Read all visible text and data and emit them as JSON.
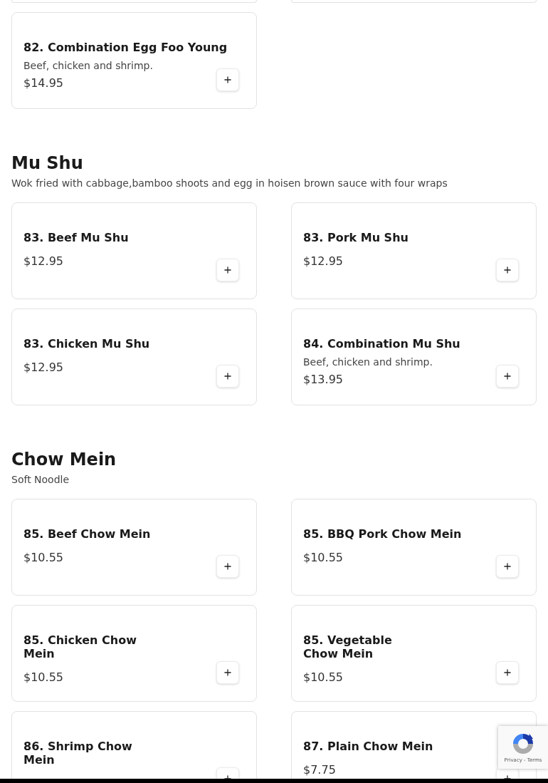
{
  "sections": [
    {
      "items": [
        {
          "kind": "partial"
        },
        {
          "kind": "partial"
        },
        {
          "kind": "item",
          "title_lines": [
            "82. Combination Egg Foo Young"
          ],
          "description": "Beef, chicken and shrimp.",
          "price": "$14.95"
        }
      ]
    },
    {
      "heading": "Mu Shu",
      "description": "Wok fried with cabbage,bamboo shoots and egg in hoisen brown sauce with four wraps",
      "items": [
        {
          "kind": "item",
          "title_lines": [
            "83. Beef Mu Shu"
          ],
          "price": "$12.95"
        },
        {
          "kind": "item",
          "title_lines": [
            "83. Pork Mu Shu"
          ],
          "price": "$12.95"
        },
        {
          "kind": "item",
          "title_lines": [
            "83. Chicken Mu Shu"
          ],
          "price": "$12.95"
        },
        {
          "kind": "item",
          "title_lines": [
            "84. Combination Mu Shu"
          ],
          "description": "Beef, chicken and shrimp.",
          "price": "$13.95"
        }
      ]
    },
    {
      "heading": "Chow Mein",
      "description": "Soft Noodle",
      "items": [
        {
          "kind": "item",
          "title_lines": [
            "85. Beef Chow Mein"
          ],
          "price": "$10.55"
        },
        {
          "kind": "item",
          "title_lines": [
            "85. BBQ Pork Chow Mein"
          ],
          "price": "$10.55"
        },
        {
          "kind": "item",
          "title_lines": [
            "85. Chicken Chow",
            "Mein"
          ],
          "price": "$10.55"
        },
        {
          "kind": "item",
          "title_lines": [
            "85. Vegetable",
            "Chow Mein"
          ],
          "price": "$10.55"
        },
        {
          "kind": "item",
          "title_lines": [
            "86. Shrimp Chow",
            "Mein"
          ]
        },
        {
          "kind": "item",
          "title_lines": [
            "87. Plain Chow Mein"
          ],
          "price": "$7.75"
        }
      ]
    }
  ],
  "recaptcha": {
    "links": "Privacy - Terms"
  }
}
